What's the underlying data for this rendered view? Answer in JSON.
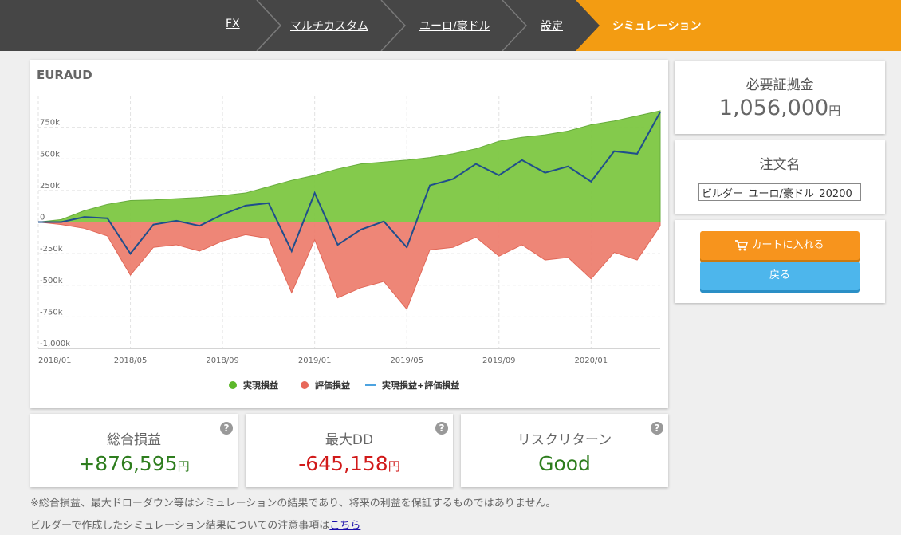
{
  "breadcrumbs": [
    {
      "label": "FX"
    },
    {
      "label": "マルチカスタム"
    },
    {
      "label": "ユーロ/豪ドル"
    },
    {
      "label": "設定"
    }
  ],
  "breadcrumb_active": "シミュレーション",
  "colors": {
    "header_bg": "#464646",
    "active_crumb": "#f39c12",
    "realized": "#7ec843",
    "unrealized": "#ee8070",
    "total_line": "#1f4e8c",
    "profit": "#2e7d1e",
    "loss": "#d11a1a",
    "good": "#2e7d1e"
  },
  "chart_data": {
    "type": "area",
    "title": "EURAUD",
    "x_ticks": [
      "2018/01",
      "2018/05",
      "2018/09",
      "2019/01",
      "2019/05",
      "2019/09",
      "2020/01"
    ],
    "y_ticks": [
      "750k",
      "500k",
      "250k",
      "0",
      "-250k",
      "-500k",
      "-750k",
      "-1,000k"
    ],
    "ylim": [
      -1000000,
      1000000
    ],
    "xlim": [
      "2018-01",
      "2020-04"
    ],
    "grid": true,
    "legend_position": "bottom",
    "x": [
      "2018-01",
      "2018-02",
      "2018-03",
      "2018-04",
      "2018-05",
      "2018-06",
      "2018-07",
      "2018-08",
      "2018-09",
      "2018-10",
      "2018-11",
      "2018-12",
      "2019-01",
      "2019-02",
      "2019-03",
      "2019-04",
      "2019-05",
      "2019-06",
      "2019-07",
      "2019-08",
      "2019-09",
      "2019-10",
      "2019-11",
      "2019-12",
      "2020-01",
      "2020-02",
      "2020-03",
      "2020-04"
    ],
    "series": [
      {
        "name": "実現損益",
        "type": "area",
        "values": [
          0,
          20000,
          90000,
          140000,
          170000,
          175000,
          185000,
          195000,
          210000,
          230000,
          280000,
          330000,
          370000,
          420000,
          460000,
          475000,
          490000,
          510000,
          540000,
          580000,
          640000,
          670000,
          690000,
          720000,
          770000,
          800000,
          840000,
          880000
        ]
      },
      {
        "name": "評価損益",
        "type": "area",
        "values": [
          0,
          -20000,
          -50000,
          -110000,
          -420000,
          -200000,
          -180000,
          -230000,
          -150000,
          -100000,
          -130000,
          -560000,
          -140000,
          -600000,
          -520000,
          -470000,
          -690000,
          -220000,
          -200000,
          -120000,
          -270000,
          -180000,
          -300000,
          -280000,
          -450000,
          -240000,
          -300000,
          -30000
        ]
      },
      {
        "name": "実現損益+評価損益",
        "type": "line",
        "values": [
          0,
          0,
          40000,
          30000,
          -250000,
          -20000,
          10000,
          -30000,
          60000,
          130000,
          150000,
          -230000,
          230000,
          -180000,
          -60000,
          5000,
          -200000,
          290000,
          340000,
          460000,
          370000,
          490000,
          390000,
          440000,
          320000,
          560000,
          540000,
          870000
        ]
      }
    ]
  },
  "margin": {
    "label": "必要証拠金",
    "value": "1,056,000",
    "unit": "円"
  },
  "order": {
    "label": "注文名",
    "value": "ビルダー_ユーロ/豪ドル_20200"
  },
  "buttons": {
    "cart": "カートに入れる",
    "back": "戻る"
  },
  "stats": [
    {
      "label": "総合損益",
      "value": "+876,595",
      "unit": "円"
    },
    {
      "label": "最大DD",
      "value": "-645,158",
      "unit": "円"
    },
    {
      "label": "リスクリターン",
      "value": "Good",
      "unit": ""
    }
  ],
  "help_mark": "?",
  "notes": {
    "line1": "※総合損益、最大ドローダウン等はシミュレーションの結果であり、将来の利益を保証するものではありません。",
    "line2_prefix": "ビルダーで作成したシミュレーション結果についての注意事項は",
    "line2_link": "こちら"
  }
}
